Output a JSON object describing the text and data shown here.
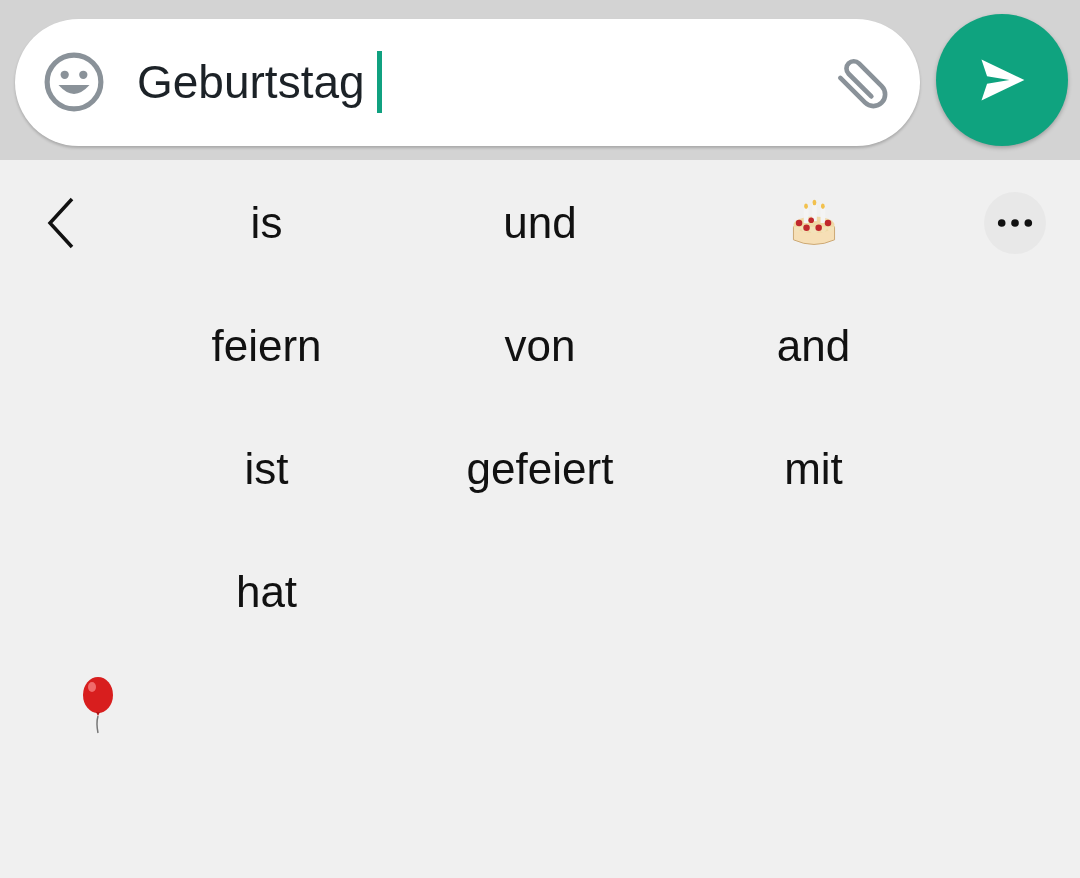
{
  "message_field": {
    "value": "Geburtstag"
  },
  "suggestions": [
    {
      "kind": "word",
      "text": "is"
    },
    {
      "kind": "word",
      "text": "und"
    },
    {
      "kind": "cake"
    },
    {
      "kind": "word",
      "text": "feiern"
    },
    {
      "kind": "word",
      "text": "von"
    },
    {
      "kind": "word",
      "text": "and"
    },
    {
      "kind": "word",
      "text": "ist"
    },
    {
      "kind": "word",
      "text": "gefeiert"
    },
    {
      "kind": "word",
      "text": "mit"
    },
    {
      "kind": "word",
      "text": "hat"
    }
  ],
  "recent_emoji": [
    {
      "kind": "balloon"
    }
  ]
}
